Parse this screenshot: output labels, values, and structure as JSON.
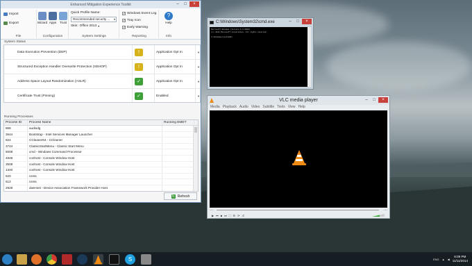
{
  "emet": {
    "title": "Enhanced Mitigation Experience Toolkit",
    "window_buttons": [
      "–",
      "□",
      "×"
    ],
    "ribbon": {
      "file": {
        "import_label": "Import",
        "export_label": "Export",
        "group_label": "File"
      },
      "configuration": {
        "wizard_label": "Wizard",
        "apps_label": "Apps",
        "trust_label": "Trust",
        "group_label": "Configuration"
      },
      "system_settings": {
        "profile_label": "Quick Profile Name:",
        "profile_value": "Recommended security ...",
        "skin_label": "Skin:",
        "skin_value": "Office 2013",
        "group_label": "System Settings"
      },
      "reporting": {
        "event_log_label": "Windows Event Log",
        "tray_icon_label": "Tray Icon",
        "early_warning_label": "Early Warning",
        "group_label": "Reporting"
      },
      "info": {
        "help_label": "Help",
        "group_label": "Info"
      }
    },
    "system_status": {
      "label": "System Status",
      "rows": [
        {
          "name": "Data Execution Prevention (DEP)",
          "value": "Application Opt In",
          "status": "warning"
        },
        {
          "name": "Structured Exception Handler Overwrite Protection (SEHOP)",
          "value": "Application Opt In",
          "status": "warning"
        },
        {
          "name": "Address Space Layout Randomization (ASLR)",
          "value": "Application Opt In",
          "status": "ok"
        },
        {
          "name": "Certificate Trust (Pinning)",
          "value": "Enabled",
          "status": "ok"
        }
      ]
    },
    "running_processes": {
      "label": "Running Processes",
      "columns": [
        "Process ID",
        "Process Name",
        "Running EMET"
      ],
      "rows": [
        {
          "pid": "868",
          "name": "audiodg",
          "emet": ""
        },
        {
          "pid": "3644",
          "name": "Bootstrap - Intel Services Manager Launcher",
          "emet": ""
        },
        {
          "pid": "824",
          "name": "CCleaner64 - CCleaner",
          "emet": ""
        },
        {
          "pid": "3744",
          "name": "ClassicStartMenu - Classic Start Menu",
          "emet": ""
        },
        {
          "pid": "5008",
          "name": "cmd - Windows Command Processor",
          "emet": ""
        },
        {
          "pid": "4848",
          "name": "conhost - Console Window Host",
          "emet": ""
        },
        {
          "pid": "3508",
          "name": "conhost - Console Window Host",
          "emet": ""
        },
        {
          "pid": "1340",
          "name": "conhost - Console Window Host",
          "emet": ""
        },
        {
          "pid": "620",
          "name": "csrss",
          "emet": ""
        },
        {
          "pid": "512",
          "name": "csrss",
          "emet": ""
        },
        {
          "pid": "2928",
          "name": "dasHost - Device Association Framework Provider Host",
          "emet": ""
        }
      ]
    },
    "refresh_label": "Refresh"
  },
  "cmd": {
    "title": "C:\\Windows\\System32\\cmd.exe",
    "lines": [
      "Microsoft Windows [Version 6.3.9600]",
      "(c) 2013 Microsoft Corporation. All rights reserved.",
      "",
      "C:\\Windows\\system32>"
    ]
  },
  "vlc": {
    "title": "VLC media player",
    "menu": [
      "Media",
      "Playback",
      "Audio",
      "Video",
      "Subtitle",
      "Tools",
      "View",
      "Help"
    ],
    "time_elapsed": "--:--",
    "time_total": "--:--"
  },
  "taskbar": {
    "tray_lang": "ENG",
    "time": "6:09 PM",
    "date": "11/11/2014"
  },
  "colors": {
    "warning_badge": "#d8b21a",
    "ok_badge": "#3fa03a",
    "close_button": "#c7413a",
    "vlc_orange": "#ef8a12"
  },
  "icons": [
    "import-icon",
    "export-icon",
    "wizard-icon",
    "apps-icon",
    "trust-icon",
    "help-icon",
    "warning-icon",
    "check-icon",
    "refresh-icon",
    "vlc-cone-icon",
    "windows-start-icon",
    "folder-icon",
    "firefox-icon",
    "chrome-icon",
    "steam-icon",
    "skype-icon"
  ]
}
